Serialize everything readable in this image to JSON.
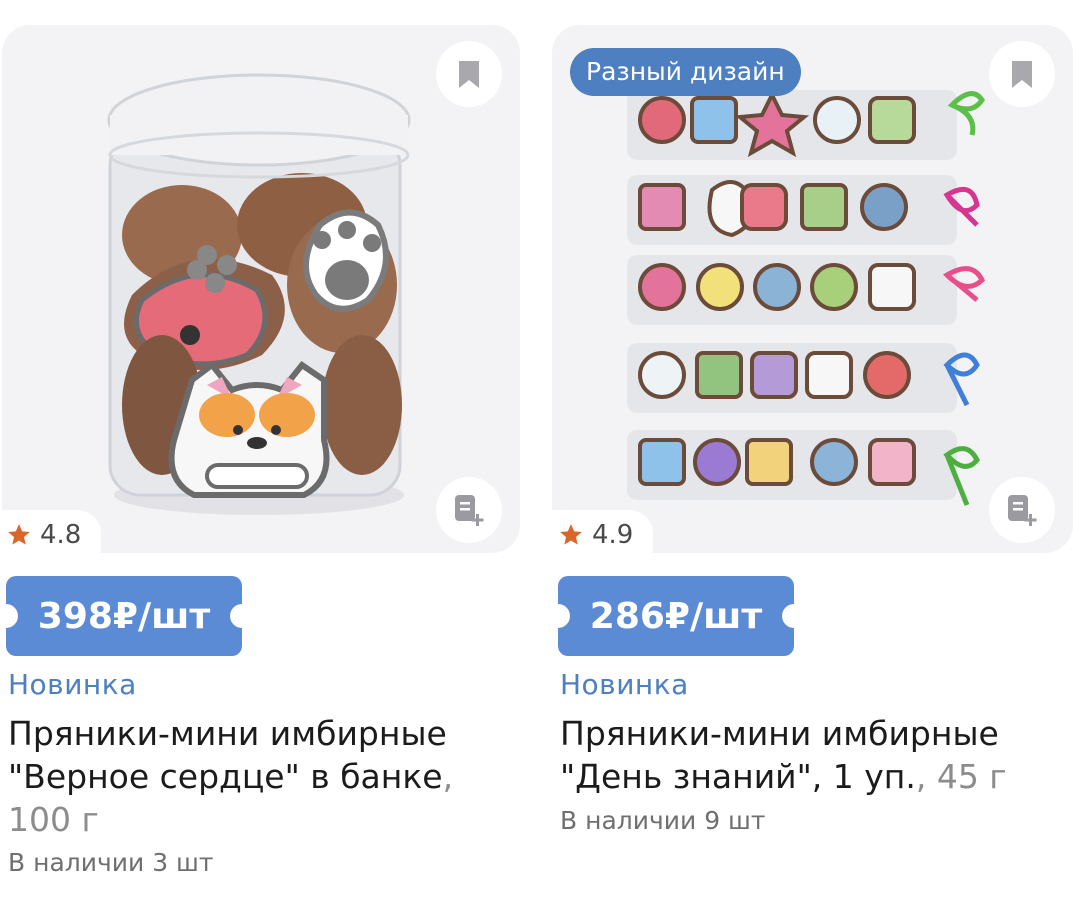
{
  "products": [
    {
      "image_alt": "",
      "badge": "",
      "rating": "4.8",
      "price": "398₽/шт",
      "label": "Новинка",
      "title": "Пряники-мини имбирные \"Верное сердце\" в банке",
      "weight": "100 г",
      "stock": "В наличии 3 шт"
    },
    {
      "image_alt": "",
      "badge": "Разный дизайн",
      "rating": "4.9",
      "price": "286₽/шт",
      "label": "Новинка",
      "title": "Пряники-мини имбирные \"День знаний\", 1 уп.",
      "weight": "45 г",
      "stock": "В наличии 9 шт"
    }
  ],
  "icons": {
    "bookmark": "bookmark-icon",
    "add_note": "add-to-list-icon",
    "star": "star-icon"
  },
  "colors": {
    "accent_blue": "#4d7fc1",
    "price_tag": "#5c8bd6",
    "star": "#d9652b",
    "text": "#1b1b1b",
    "muted": "#8c8c8c",
    "image_bg": "#f3f3f5"
  }
}
